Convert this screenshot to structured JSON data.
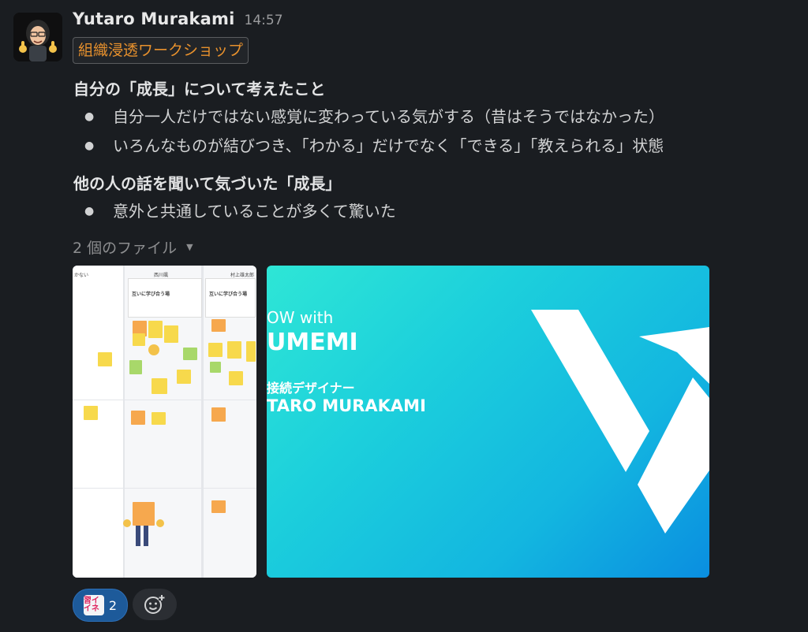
{
  "message": {
    "author": "Yutaro Murakami",
    "time": "14:57",
    "status_tag": "組織浸透ワークショップ",
    "sections": [
      {
        "heading": "自分の「成長」について考えたこと",
        "bullets": [
          "自分一人だけではない感覚に変わっている気がする（昔はそうではなかった）",
          "いろんなものが結びつき、「わかる」だけでなく「できる」「教えられる」状態"
        ]
      },
      {
        "heading": "他の人の話を聞いて気づいた「成長」",
        "bullets": [
          "意外と共通していることが多くて驚いた"
        ]
      }
    ]
  },
  "files": {
    "label": "2 個のファイル",
    "thumbnail1": {
      "col_headers": [
        "かない",
        "西川颯",
        "村上雄太郎"
      ],
      "card_title": "互いに学び合う場"
    },
    "thumbnail2": {
      "line1": "OW with",
      "line2": "UMEMI",
      "line3": "接続デザイナー",
      "line4": "TARO MURAKAMI"
    }
  },
  "reactions": {
    "emoji_text": "習イイネ",
    "count": "2"
  },
  "colors": {
    "background": "#1a1d21",
    "tag": "#e8912d",
    "reaction": "#1d5a9a"
  },
  "icons": [
    "chevron-down-icon",
    "add-reaction-icon"
  ]
}
